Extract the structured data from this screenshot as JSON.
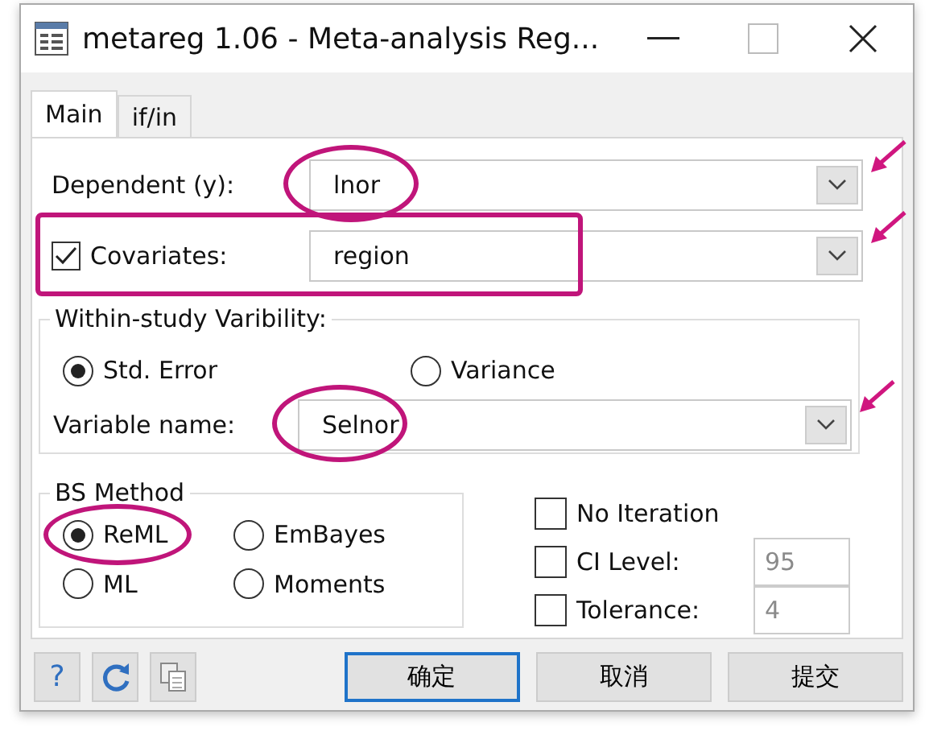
{
  "window": {
    "title": "metareg 1.06 - Meta-analysis Reg..."
  },
  "tabs": [
    {
      "label": "Main",
      "selected": true
    },
    {
      "label": "if/in",
      "selected": false
    }
  ],
  "dependent": {
    "label": "Dependent (y):",
    "value": "lnor",
    "circled": true,
    "arrowed": true
  },
  "covariates": {
    "label": "Covariates:",
    "checked": true,
    "value": "region",
    "boxed": true,
    "arrowed": true
  },
  "within_study": {
    "title": "Within-study Varibility:",
    "options": [
      {
        "label": "Std. Error",
        "selected": true
      },
      {
        "label": "Variance",
        "selected": false
      }
    ],
    "variable": {
      "label": "Variable name:",
      "value": "Selnor",
      "circled": true,
      "arrowed": true
    }
  },
  "bs_method": {
    "title": "BS Method",
    "options": [
      {
        "label": "ReML",
        "selected": true,
        "circled": true
      },
      {
        "label": "EmBayes",
        "selected": false,
        "circled": false
      },
      {
        "label": "ML",
        "selected": false,
        "circled": false
      },
      {
        "label": "Moments",
        "selected": false,
        "circled": false
      }
    ]
  },
  "settings": [
    {
      "label": "No Iteration",
      "checked": false
    },
    {
      "label": "CI Level:",
      "checked": false,
      "value": "95"
    },
    {
      "label": "Tolerance:",
      "checked": false,
      "value": "4"
    }
  ],
  "help_button": "?",
  "buttons": [
    {
      "label": "确定",
      "default": true
    },
    {
      "label": "取消",
      "default": false
    },
    {
      "label": "提交",
      "default": false
    }
  ]
}
